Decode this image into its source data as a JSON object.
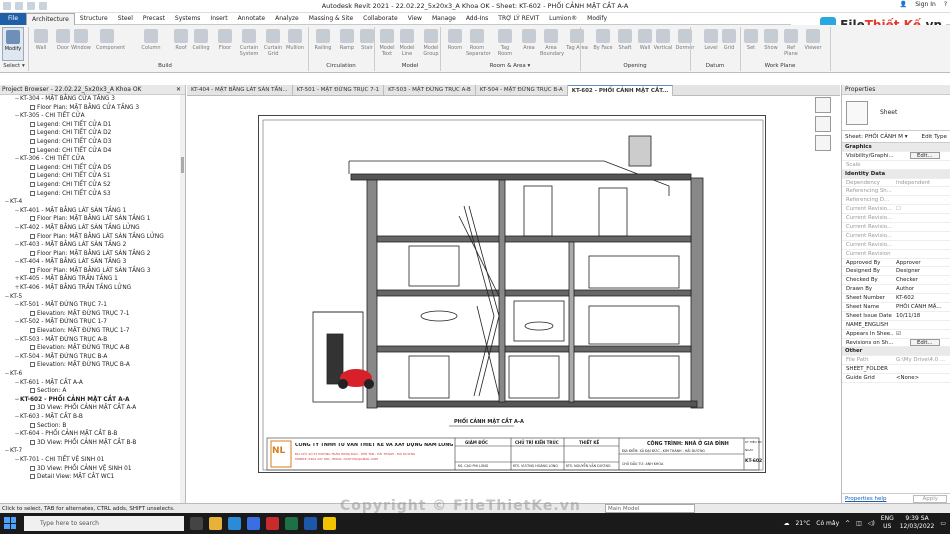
{
  "window": {
    "title": "Autodesk Revit 2021 - 22.02.22_5x20x3_A Khoa OK - Sheet: KT-602 - PHỐI CẢNH MẶT CẮT A-A",
    "signin": "Sign In"
  },
  "menu": [
    "File",
    "Architecture",
    "Structure",
    "Steel",
    "Precast",
    "Systems",
    "Insert",
    "Annotate",
    "Analyze",
    "Massing & Site",
    "Collaborate",
    "View",
    "Manage",
    "Add-Ins",
    "TRỢ LÝ REVIT",
    "Lumion®",
    "Modify"
  ],
  "ribbon": {
    "buttons": [
      "Modify",
      "Wall",
      "Door",
      "Window",
      "Component",
      "Column",
      "Roof",
      "Ceiling",
      "Floor",
      "Curtain System",
      "Curtain Grid",
      "Mullion",
      "Railing",
      "Ramp",
      "Stair",
      "Model Text",
      "Model Line",
      "Model Group",
      "Room",
      "Room Separator",
      "Tag Room",
      "Area",
      "Area Boundary",
      "Tag Area",
      "By Face",
      "Shaft",
      "Wall",
      "Vertical",
      "Dormer",
      "Level",
      "Grid",
      "Set",
      "Show",
      "Ref Plane",
      "Viewer"
    ],
    "groups": [
      "Select ▾",
      "Build",
      "Circulation",
      "Model",
      "Room & Area ▾",
      "Opening",
      "Datum",
      "Work Plane"
    ]
  },
  "brand": {
    "name_a": "File",
    "name_b": "Thiết Kế",
    "suffix": ".vn"
  },
  "project_browser": {
    "title": "Project Browser - 22.02.22_5x20x3_A Khoa OK",
    "items": [
      {
        "t": "KT-304 - MẶT BẰNG CỬA TẦNG 3",
        "lv": 2,
        "ex": "−"
      },
      {
        "t": "Floor Plan: MẶT BẰNG CỬA TẦNG 3",
        "lv": 3,
        "ic": true
      },
      {
        "t": "KT-305 - CHI TIẾT CỬA",
        "lv": 2,
        "ex": "−"
      },
      {
        "t": "Legend: CHI TIẾT CỬA D1",
        "lv": 3,
        "ic": true
      },
      {
        "t": "Legend: CHI TIẾT CỬA D2",
        "lv": 3,
        "ic": true
      },
      {
        "t": "Legend: CHI TIẾT CỬA D3",
        "lv": 3,
        "ic": true
      },
      {
        "t": "Legend: CHI TIẾT CỬA D4",
        "lv": 3,
        "ic": true
      },
      {
        "t": "KT-306 - CHI TIẾT CỬA",
        "lv": 2,
        "ex": "−"
      },
      {
        "t": "Legend: CHI TIẾT CỬA D5",
        "lv": 3,
        "ic": true
      },
      {
        "t": "Legend: CHI TIẾT CỬA S1",
        "lv": 3,
        "ic": true
      },
      {
        "t": "Legend: CHI TIẾT CỬA S2",
        "lv": 3,
        "ic": true
      },
      {
        "t": "Legend: CHI TIẾT CỬA S3",
        "lv": 3,
        "ic": true
      },
      {
        "t": "KT-4",
        "lv": 1,
        "ex": "−"
      },
      {
        "t": "KT-401 - MẶT BẰNG LÁT SÀN TẦNG 1",
        "lv": 2,
        "ex": "−"
      },
      {
        "t": "Floor Plan: MẶT BẰNG LÁT SÀN TẦNG 1",
        "lv": 3,
        "ic": true
      },
      {
        "t": "KT-402 - MẶT BẰNG LÁT SÀN TẦNG LỬNG",
        "lv": 2,
        "ex": "−"
      },
      {
        "t": "Floor Plan: MẶT BẰNG LÁT SÀN TẦNG LỬNG",
        "lv": 3,
        "ic": true
      },
      {
        "t": "KT-403 - MẶT BẰNG LÁT SÀN TẦNG 2",
        "lv": 2,
        "ex": "−"
      },
      {
        "t": "Floor Plan: MẶT BẰNG LÁT SÀN TẦNG 2",
        "lv": 3,
        "ic": true
      },
      {
        "t": "KT-404 - MẶT BẰNG LÁT SÀN TẦNG 3",
        "lv": 2,
        "ex": "−"
      },
      {
        "t": "Floor Plan: MẶT BẰNG LÁT SÀN TẦNG 3",
        "lv": 3,
        "ic": true
      },
      {
        "t": "KT-405 - MẶT BẰNG TRẦN TẦNG 1",
        "lv": 2,
        "ex": "+"
      },
      {
        "t": "KT-406 - MẶT BẰNG TRẦN TẦNG LỬNG",
        "lv": 2,
        "ex": "+"
      },
      {
        "t": "KT-5",
        "lv": 1,
        "ex": "−"
      },
      {
        "t": "KT-501 - MẶT ĐỨNG TRỤC 7-1",
        "lv": 2,
        "ex": "−"
      },
      {
        "t": "Elevation: MẶT ĐỨNG TRỤC 7-1",
        "lv": 3,
        "ic": true
      },
      {
        "t": "KT-502 - MẶT ĐỨNG TRỤC 1-7",
        "lv": 2,
        "ex": "−"
      },
      {
        "t": "Elevation: MẶT ĐỨNG TRỤC 1-7",
        "lv": 3,
        "ic": true
      },
      {
        "t": "KT-503 - MẶT ĐỨNG TRỤC A-B",
        "lv": 2,
        "ex": "−"
      },
      {
        "t": "Elevation: MẶT ĐỨNG TRỤC A-B",
        "lv": 3,
        "ic": true
      },
      {
        "t": "KT-504 - MẶT ĐỨNG  TRỤC B-A",
        "lv": 2,
        "ex": "−"
      },
      {
        "t": "Elevation: MẶT ĐỨNG  TRỤC B-A",
        "lv": 3,
        "ic": true
      },
      {
        "t": "KT-6",
        "lv": 1,
        "ex": "−"
      },
      {
        "t": "KT-601 - MẶT CẮT A-A",
        "lv": 2,
        "ex": "−"
      },
      {
        "t": "Section: A",
        "lv": 3,
        "ic": true
      },
      {
        "t": "KT-602 - PHỐI CẢNH MẶT CẮT A-A",
        "lv": 2,
        "ex": "−",
        "sel": true
      },
      {
        "t": "3D View: PHỐI CẢNH MẶT CẮT A-A",
        "lv": 3,
        "ic": true
      },
      {
        "t": "KT-603 - MẶT CẮT B-B",
        "lv": 2,
        "ex": "−"
      },
      {
        "t": "Section: B",
        "lv": 3,
        "ic": true
      },
      {
        "t": "KT-604 - PHỐI CẢNH MẶT CẮT B-B",
        "lv": 2,
        "ex": "−"
      },
      {
        "t": "3D View: PHỐI CẢNH MẶT CẮT B-B",
        "lv": 3,
        "ic": true
      },
      {
        "t": "KT-7",
        "lv": 1,
        "ex": "−"
      },
      {
        "t": "KT-701 - CHI TIẾT VỆ SINH 01",
        "lv": 2,
        "ex": "−"
      },
      {
        "t": "3D View: PHỐI CẢNH VỆ SINH 01",
        "lv": 3,
        "ic": true
      },
      {
        "t": "Detail View: MẶT CẮT WC1",
        "lv": 3,
        "ic": true
      }
    ]
  },
  "tabs": [
    "KT-404 - MẶT BẰNG LÁT SÀN TẦN...",
    "KT-501 - MẶT ĐỨNG TRỤC 7-1",
    "KT-503 - MẶT ĐỨNG TRỤC A-B",
    "KT-504 - MẶT ĐỨNG  TRỤC B-A",
    "KT-602 - PHỐI CẢNH MẶT CẮT..."
  ],
  "sheet": {
    "drawing_label": "PHỐI CẢNH MẶT CẮT A-A",
    "company": "CÔNG TY TNHH TƯ VẤN THIẾT KẾ VÀ XÂY DỰNG NAM LONG",
    "logo": "NL",
    "company_addr": "ĐỊA CHỈ: SỐ 47 ĐƯỜNG TRẦN HƯNG ĐẠO - PHỐ TÂN - HẢI THÀNH - HẢI DƯƠNG",
    "company_contact": "MOBILE: 0904 447 000 - EMAIL: CGSTYNL@GMAIL.COM",
    "giam_doc": "GIÁM ĐỐC",
    "giam_doc_name": "KS. CAO PHI LONG",
    "chu_tri": "CHỦ TRÌ KIẾN TRÚC",
    "chu_tri_name": "KTS. VƯƠNG HOÀNG LONG",
    "thiet_ke": "THIẾT KẾ",
    "thiet_ke_name": "KTS. NGUYỄN VĂN DƯƠNG",
    "project": "CÔNG TRÌNH: NHÀ Ở GIA ĐÌNH",
    "project_addr": "ĐỊA ĐIỂM: XÃ ĐẠI ĐỨC - KIM THÀNH - HẢI DƯƠNG",
    "owner": "CHỦ ĐẦU TƯ: ANH KHOA",
    "num_label": "KÝ HIỆU BV",
    "date": "NGÀY",
    "sheet_no": "KT-602"
  },
  "properties": {
    "title": "Properties",
    "type_name": "Sheet",
    "selector": "Sheet: PHỐI CẢNH M",
    "edit_type": "Edit Type",
    "rows": [
      {
        "sec": "Graphics"
      },
      {
        "k": "Visibility/Graphi...",
        "btn": "Edit..."
      },
      {
        "k": "Scale",
        "v": "",
        "grey": true
      },
      {
        "sec": "Identity Data"
      },
      {
        "k": "Dependency",
        "v": "Independent",
        "grey": true
      },
      {
        "k": "Referencing Sh...",
        "v": "",
        "grey": true
      },
      {
        "k": "Referencing D...",
        "v": "",
        "grey": true
      },
      {
        "k": "Current Revisio...",
        "v": "",
        "grey": true,
        "cb": true
      },
      {
        "k": "Current Revisio...",
        "v": "",
        "grey": true
      },
      {
        "k": "Current Revisio...",
        "v": "",
        "grey": true
      },
      {
        "k": "Current Revisio...",
        "v": "",
        "grey": true
      },
      {
        "k": "Current Revisio...",
        "v": "",
        "grey": true
      },
      {
        "k": "Current Revision",
        "v": "",
        "grey": true
      },
      {
        "k": "Approved By",
        "v": "Approver"
      },
      {
        "k": "Designed By",
        "v": "Designer"
      },
      {
        "k": "Checked By",
        "v": "Checker"
      },
      {
        "k": "Drawn By",
        "v": "Author"
      },
      {
        "k": "Sheet Number",
        "v": "KT-602"
      },
      {
        "k": "Sheet Name",
        "v": "PHỐI CẢNH MẶ..."
      },
      {
        "k": "Sheet Issue Date",
        "v": "10/11/18"
      },
      {
        "k": "NAME_ENGLISH",
        "v": ""
      },
      {
        "k": "Appears In Shee...",
        "v": "",
        "cb": true,
        "checked": true
      },
      {
        "k": "Revisions on Sh...",
        "btn": "Edit..."
      },
      {
        "sec": "Other"
      },
      {
        "k": "File Path",
        "v": "G:\\My Drive\\4.0 ...",
        "grey": true
      },
      {
        "k": "SHEET_FOLDER",
        "v": ""
      },
      {
        "k": "Guide Grid",
        "v": "<None>"
      }
    ],
    "help": "Properties help",
    "apply": "Apply"
  },
  "status": {
    "hint": "Click to select, TAB for alternates, CTRL adds, SHIFT unselects.",
    "model": "Main Model"
  },
  "taskbar": {
    "search": "Type here to search",
    "temp": "21°C",
    "weather": "Có mây",
    "lang": "ENG",
    "region": "US",
    "time": "9:39 SA",
    "date": "12/03/2022"
  },
  "watermark": "Copyright © FileThietKe.vn",
  "colors": {
    "accent": "#1f5fa8",
    "revit": "#1c57a8",
    "excel": "#1e7145",
    "moto": "#d8202a"
  }
}
